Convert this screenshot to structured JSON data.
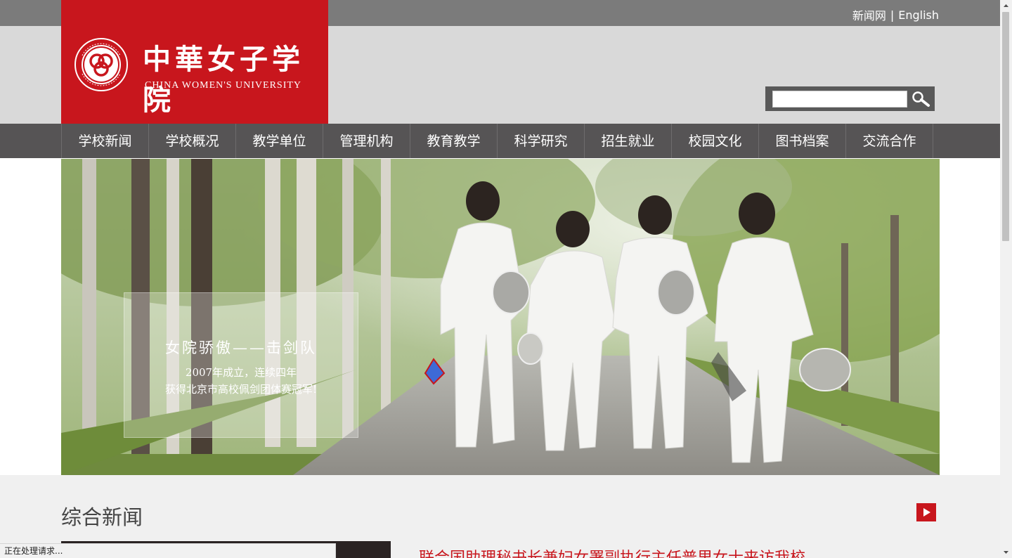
{
  "topbar": {
    "links": [
      "新闻网",
      "English"
    ],
    "separator": "|"
  },
  "logo": {
    "cn": "中華女子学院",
    "en": "CHINA WOMEN'S UNIVERSITY",
    "emblem_text": "中華女子学院 CHINA WOMEN'S UNIVERSITY"
  },
  "search": {
    "value": "",
    "placeholder": ""
  },
  "nav": {
    "items": [
      "学校新闻",
      "学校概况",
      "教学单位",
      "管理机构",
      "教育教学",
      "科学研究",
      "招生就业",
      "校园文化",
      "图书档案",
      "交流合作"
    ]
  },
  "banner": {
    "title": "女院骄傲——击剑队",
    "line1": "2007年成立，连续四年",
    "line2": "获得北京市高校佩剑团体赛冠军!"
  },
  "news": {
    "section_title": "综合新闻",
    "headline": "联合国助理秘书长兼妇女署副执行主任普里女士来访我校"
  },
  "status_bar": {
    "text": "正在处理请求..."
  },
  "colors": {
    "brand_red": "#c8161d",
    "nav_bg": "#565455",
    "topbar_bg": "#7b7b7b",
    "header_bg": "#d9d9d9"
  }
}
